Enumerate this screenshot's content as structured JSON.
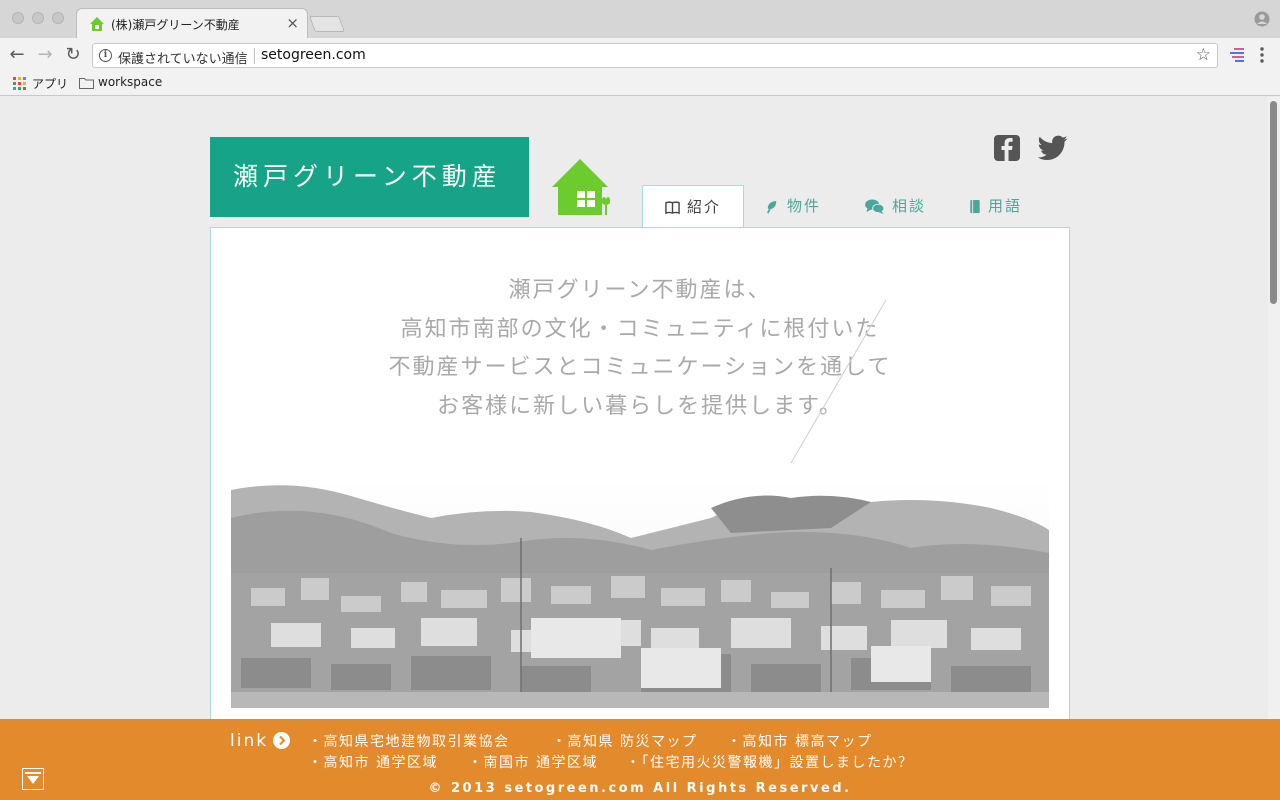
{
  "browser": {
    "tab_title": "(株)瀬戸グリーン不動産",
    "tab_close": "×",
    "security_label": "保護されていない通信",
    "url": "setogreen.com",
    "back_icon": "←",
    "forward_icon": "→",
    "reload_icon": "↻",
    "star_icon": "☆",
    "bookmarks": [
      {
        "label": "アプリ",
        "icon": "apps-grid-icon"
      },
      {
        "label": "workspace",
        "icon": "folder-icon"
      }
    ]
  },
  "site": {
    "logo_text": "瀬戸グリーン不動産",
    "brand_color": "#16a387",
    "accent_color": "#e38a2c",
    "social": [
      "facebook-icon",
      "twitter-icon"
    ],
    "nav": [
      {
        "label": "紹介",
        "icon": "book-icon",
        "active": true
      },
      {
        "label": "物件",
        "icon": "seedling-icon",
        "active": false
      },
      {
        "label": "相談",
        "icon": "chat-icon",
        "active": false
      },
      {
        "label": "用語",
        "icon": "notebook-icon",
        "active": false
      }
    ],
    "intro_lines": [
      "瀬戸グリーン不動産は、",
      "高知市南部の文化・コミュニティに根付いた",
      "不動産サービスとコミュニケーションを通して",
      "お客様に新しい暮らしを提供します。"
    ]
  },
  "footer": {
    "link_label": "link",
    "links_row1": [
      "・高知県宅地建物取引業協会",
      "・高知県 防災マップ",
      "・高知市 標高マップ"
    ],
    "links_row2": [
      "・高知市 通学区域",
      "・南国市 通学区域",
      "・「住宅用火災警報機」設置しましたか？"
    ],
    "copyright": "© 2013 setogreen.com All Rights Reserved."
  }
}
